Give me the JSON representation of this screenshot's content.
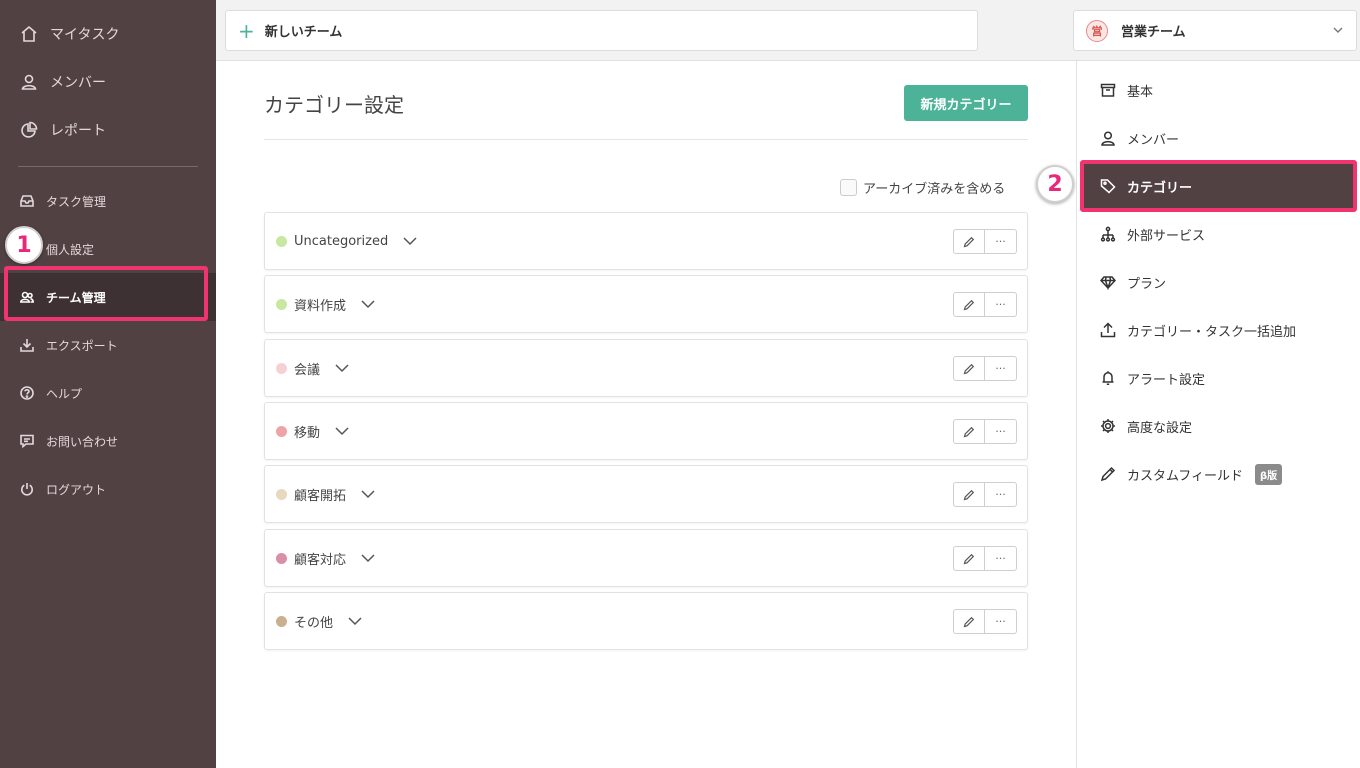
{
  "sidebar": {
    "top_items": [
      {
        "label": "マイタスク",
        "icon": "home-icon"
      },
      {
        "label": "メンバー",
        "icon": "user-icon"
      },
      {
        "label": "レポート",
        "icon": "pie-chart-icon"
      }
    ],
    "sub_items": [
      {
        "label": "タスク管理",
        "icon": "inbox-icon"
      },
      {
        "label": "個人設定",
        "icon": "person-settings-icon"
      },
      {
        "label": "チーム管理",
        "icon": "team-icon",
        "active": true
      },
      {
        "label": "エクスポート",
        "icon": "download-icon"
      },
      {
        "label": "ヘルプ",
        "icon": "help-icon"
      },
      {
        "label": "お問い合わせ",
        "icon": "chat-icon"
      },
      {
        "label": "ログアウト",
        "icon": "power-icon"
      }
    ]
  },
  "callouts": {
    "one": "1",
    "two": "2"
  },
  "topbar": {
    "new_team_label": "新しいチーム",
    "team_name": "営業チーム",
    "team_logo_text": "営"
  },
  "main": {
    "title": "カテゴリー設定",
    "new_category_button": "新規カテゴリー",
    "include_archived_label": "アーカイブ済みを含める",
    "more_label": "···",
    "categories": [
      {
        "name": "Uncategorized",
        "color": "#c6e8a1"
      },
      {
        "name": "資料作成",
        "color": "#c6e8a1"
      },
      {
        "name": "会議",
        "color": "#f6d1d3"
      },
      {
        "name": "移動",
        "color": "#eea3a5"
      },
      {
        "name": "顧客開拓",
        "color": "#e8d8bd"
      },
      {
        "name": "顧客対応",
        "color": "#d98fa7"
      },
      {
        "name": "その他",
        "color": "#c9b08e"
      }
    ]
  },
  "settings_menu": {
    "items": [
      {
        "label": "基本",
        "icon": "archive-icon"
      },
      {
        "label": "メンバー",
        "icon": "user-icon"
      },
      {
        "label": "カテゴリー",
        "icon": "tag-icon",
        "active": true
      },
      {
        "label": "外部サービス",
        "icon": "integration-icon"
      },
      {
        "label": "プラン",
        "icon": "diamond-icon"
      },
      {
        "label": "カテゴリー・タスク一括追加",
        "icon": "upload-icon"
      },
      {
        "label": "アラート設定",
        "icon": "bell-icon"
      },
      {
        "label": "高度な設定",
        "icon": "gear-icon"
      },
      {
        "label": "カスタムフィールド",
        "icon": "pencil-icon",
        "badge": "β版"
      }
    ]
  },
  "colors": {
    "sidebar_bg": "#524143",
    "accent_green": "#4cb398",
    "highlight_pink": "#f0346f"
  }
}
